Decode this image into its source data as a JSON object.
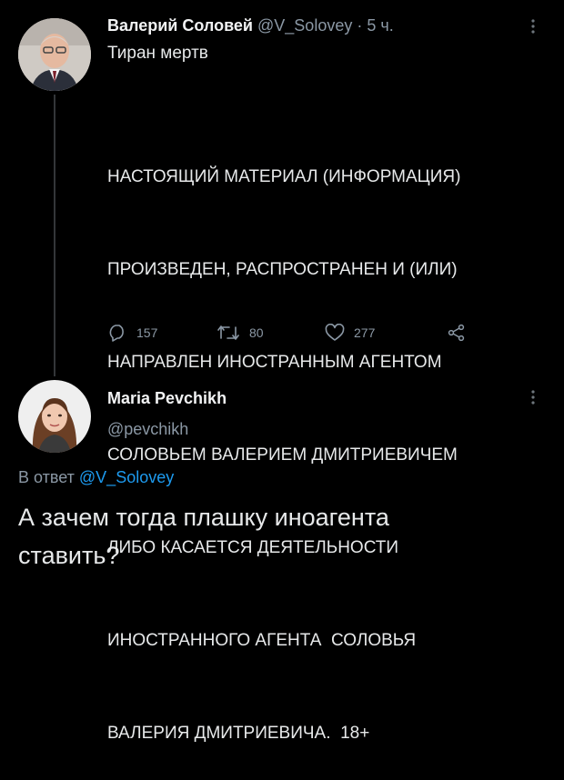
{
  "tweet1": {
    "author_name": "Валерий Соловей",
    "handle": "@V_Solovey",
    "separator": "·",
    "time": "5 ч.",
    "text": "Тиран мертв",
    "disclaimer_lines": [
      "НАСТОЯЩИЙ МАТЕРИАЛ (ИНФОРМАЦИЯ)",
      "ПРОИЗВЕДЕН, РАСПРОСТРАНЕН И (ИЛИ)",
      "НАПРАВЛЕН ИНОСТРАННЫМ АГЕНТОМ",
      "СОЛОВЬЕМ ВАЛЕРИЕМ ДМИТРИЕВИЧЕМ",
      "ЛИБО КАСАЕТСЯ ДЕЯТЕЛЬНОСТИ",
      "ИНОСТРАННОГО АГЕНТА  СОЛОВЬЯ",
      "ВАЛЕРИЯ ДМИТРИЕВИЧА.  18+"
    ],
    "replies": "157",
    "retweets": "80",
    "likes": "277"
  },
  "tweet2": {
    "author_name": "Maria Pevchikh",
    "handle": "@pevchikh",
    "reply_prefix": "В ответ",
    "reply_to": "@V_Solovey",
    "text_lines": [
      "А зачем тогда плашку иноагента",
      "ставить?"
    ]
  },
  "icons": [
    "reply-icon",
    "retweet-icon",
    "like-icon",
    "share-icon",
    "more-icon"
  ],
  "colors": {
    "background": "#000000",
    "text": "#e7e9ea",
    "muted": "#8b98a5",
    "link": "#1d9bf0"
  }
}
